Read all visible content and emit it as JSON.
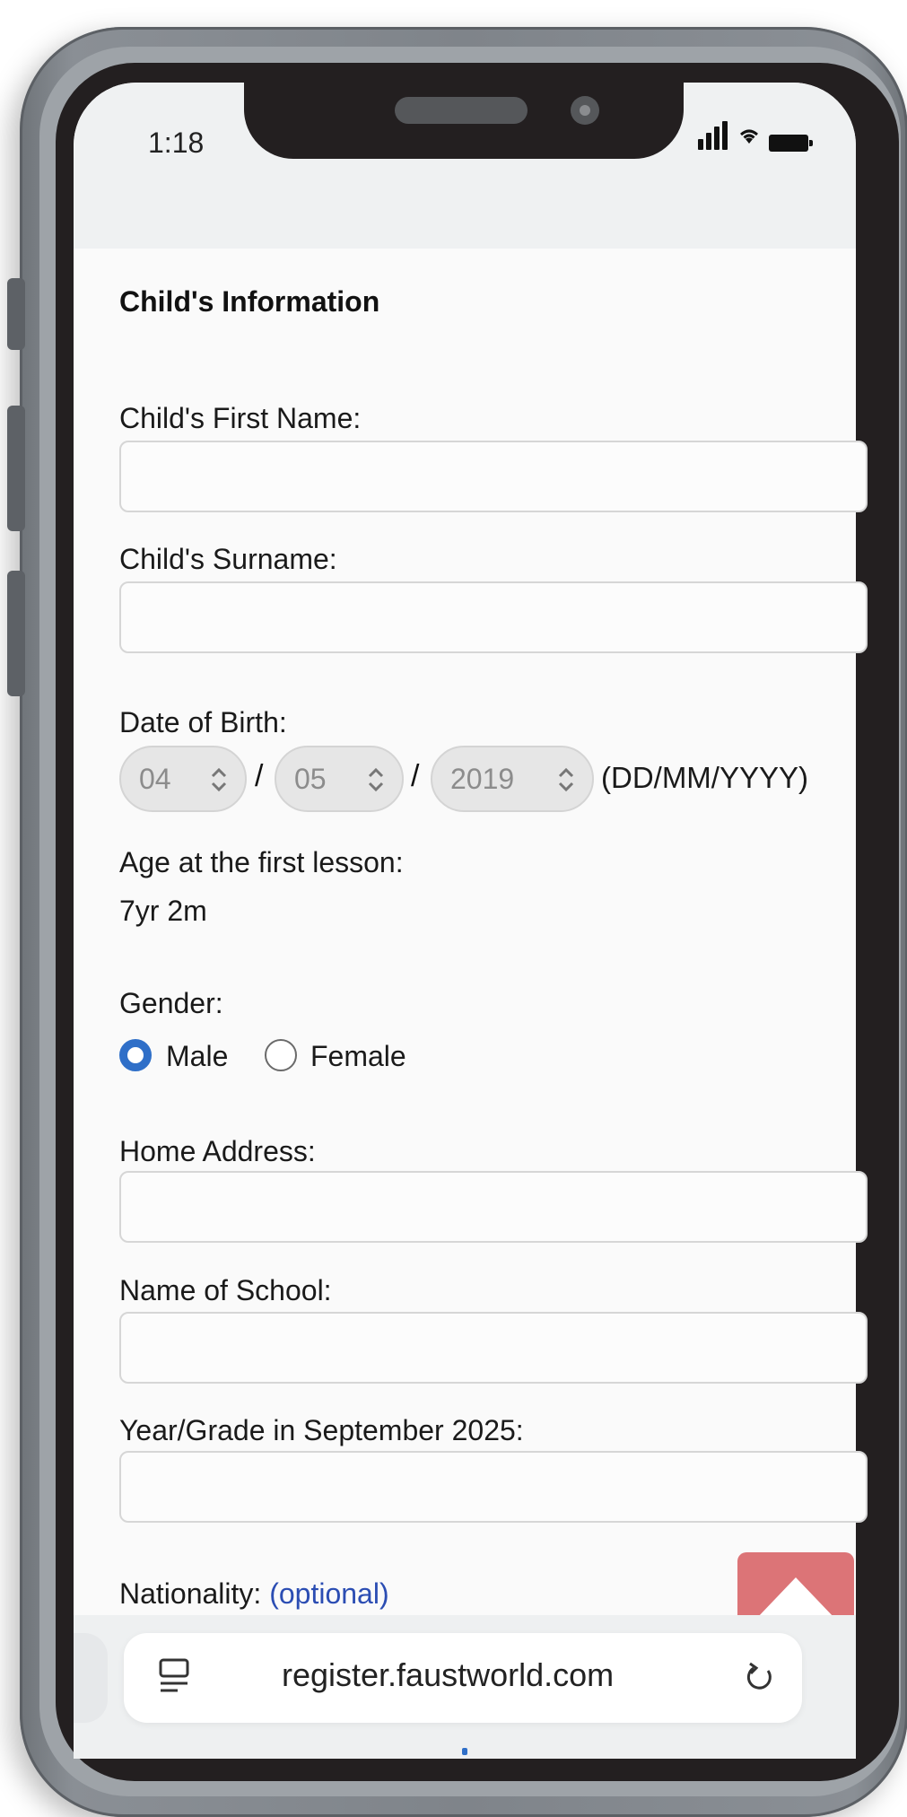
{
  "status_bar": {
    "time": "1:18",
    "signal_icon": "signal-bars-icon",
    "wifi_icon": "wifi-icon",
    "battery_icon": "battery-icon"
  },
  "form": {
    "section_title": "Child's Information",
    "first_name": {
      "label": "Child's First Name:",
      "value": ""
    },
    "surname": {
      "label": "Child's Surname:",
      "value": ""
    },
    "dob": {
      "label": "Date of Birth:",
      "day": "04",
      "month": "05",
      "year": "2019",
      "separator": "/",
      "format_hint": "(DD/MM/YYYY)"
    },
    "age": {
      "label": "Age at the first lesson:",
      "value": "7yr 2m"
    },
    "gender": {
      "label": "Gender:",
      "options": [
        "Male",
        "Female"
      ],
      "selected": "Male"
    },
    "home_address": {
      "label": "Home Address:",
      "value": ""
    },
    "school": {
      "label": "Name of School:",
      "value": ""
    },
    "grade": {
      "label": "Year/Grade in September 2025:",
      "value": ""
    },
    "nationality": {
      "label": "Nationality:",
      "optional": "(optional)"
    }
  },
  "browser": {
    "url": "register.faustworld.com",
    "tabs_icon": "reader-icon",
    "reload_icon": "reload-icon"
  },
  "colors": {
    "accent": "#2f6fc8",
    "scroll_top_button": "#dc7477",
    "phone_bezel": "#231f20"
  }
}
